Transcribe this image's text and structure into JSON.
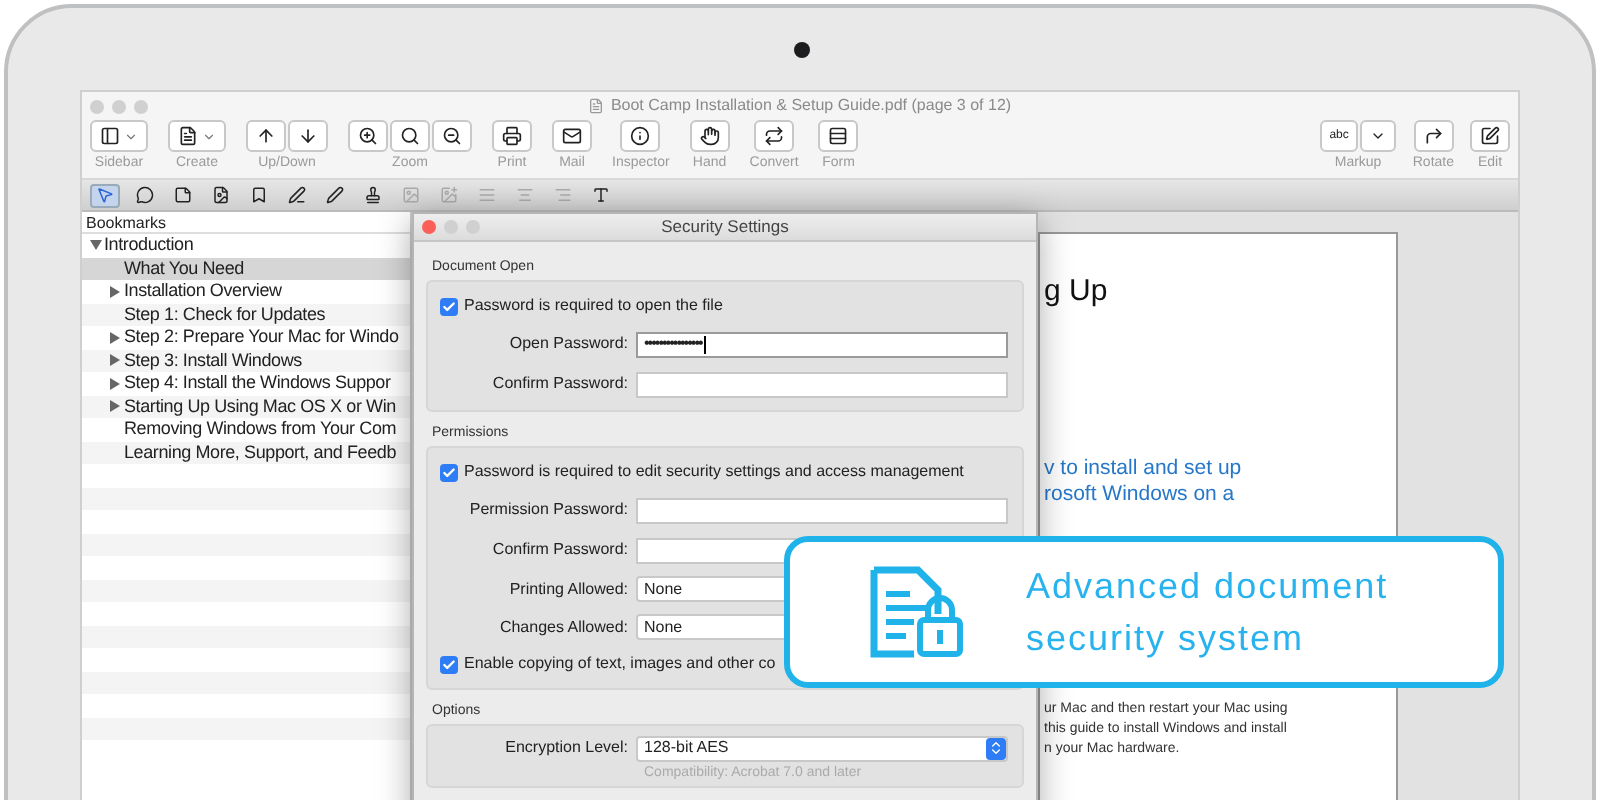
{
  "window": {
    "title": "Boot Camp Installation & Setup Guide.pdf (page 3 of 12)"
  },
  "toolbar": [
    {
      "label": "Sidebar",
      "kind": "dropdown"
    },
    {
      "label": "Create",
      "kind": "dropdown"
    },
    {
      "label": "Up/Down",
      "kind": "pair"
    },
    {
      "label": "Zoom",
      "kind": "triple"
    },
    {
      "label": "Print",
      "kind": "single"
    },
    {
      "label": "Mail",
      "kind": "single"
    },
    {
      "label": "Inspector",
      "kind": "single"
    },
    {
      "label": "Hand",
      "kind": "single"
    },
    {
      "label": "Convert",
      "kind": "single"
    },
    {
      "label": "Form",
      "kind": "single"
    }
  ],
  "toolbar_right": [
    {
      "label": "Markup",
      "kind": "markup",
      "text": "abc"
    },
    {
      "label": "Rotate",
      "kind": "single"
    },
    {
      "label": "Edit",
      "kind": "single"
    }
  ],
  "format_tools": [
    {
      "selected": true
    },
    {
      "selected": false
    },
    {
      "selected": false
    },
    {
      "selected": false
    },
    {
      "selected": false
    },
    {
      "selected": false
    },
    {
      "selected": false
    },
    {
      "selected": false
    },
    {
      "selected": false
    },
    {
      "selected": false
    },
    {
      "selected": false
    },
    {
      "selected": false
    },
    {
      "selected": false
    },
    {
      "selected": false
    }
  ],
  "sidebar": {
    "title": "Bookmarks",
    "items": [
      {
        "label": "Introduction",
        "kind": "branch",
        "expanded": true,
        "selected": false,
        "children": [
          {
            "label": "What You Need",
            "kind": "leaf",
            "selected": true
          },
          {
            "label": "Installation Overview",
            "kind": "branch",
            "expanded": false,
            "selected": false
          },
          {
            "label": "Step 1: Check for Updates",
            "kind": "leaf",
            "selected": false
          },
          {
            "label": "Step 2: Prepare Your Mac for Windo",
            "kind": "branch",
            "expanded": false,
            "selected": false
          },
          {
            "label": "Step 3: Install Windows",
            "kind": "branch",
            "expanded": false,
            "selected": false
          },
          {
            "label": "Step 4: Install the Windows Suppor",
            "kind": "branch",
            "expanded": false,
            "selected": false
          },
          {
            "label": "Starting Up Using Mac OS X or Win",
            "kind": "branch",
            "expanded": false,
            "selected": false
          },
          {
            "label": "Removing Windows from Your Com",
            "kind": "leaf",
            "selected": false
          },
          {
            "label": "Learning More, Support, and Feedb",
            "kind": "leaf",
            "selected": false
          }
        ]
      }
    ]
  },
  "dialog": {
    "title": "Security Settings",
    "sections": [
      {
        "title": "Document Open",
        "rows": [
          {
            "kind": "checkbox",
            "label": "Password is required to open the file",
            "checked": true
          },
          {
            "kind": "field",
            "label": "Open Password:",
            "value": "••••••••••••••••",
            "focused": true
          },
          {
            "kind": "field",
            "label": "Confirm Password:",
            "focused": false
          }
        ]
      },
      {
        "title": "Permissions",
        "rows": [
          {
            "kind": "checkbox",
            "label": "Password is required to edit security settings and access management",
            "checked": true
          },
          {
            "kind": "field",
            "label": "Permission Password:",
            "focused": false
          },
          {
            "kind": "field",
            "label": "Confirm Password:",
            "focused": false
          },
          {
            "kind": "select",
            "label": "Printing Allowed:",
            "value": "None"
          },
          {
            "kind": "select",
            "label": "Changes Allowed:",
            "value": "None"
          },
          {
            "kind": "checkbox",
            "label": "Enable copying of text, images and other co",
            "checked": true
          }
        ]
      },
      {
        "title": "Options",
        "rows": [
          {
            "kind": "popup",
            "label": "Encryption Level:",
            "value": "128-bit AES"
          },
          {
            "kind": "note",
            "label": "Compatibility: Acrobat 7.0 and later"
          }
        ]
      }
    ]
  },
  "page": {
    "heading": "g Up",
    "intro": [
      "v to install and set up",
      "rosoft Windows on a"
    ],
    "body": [
      "ur Mac and then restart your Mac using",
      "this guide to install Windows and install",
      "n your Mac hardware."
    ]
  },
  "callout": {
    "lines": [
      "Advanced document",
      "security system"
    ]
  }
}
